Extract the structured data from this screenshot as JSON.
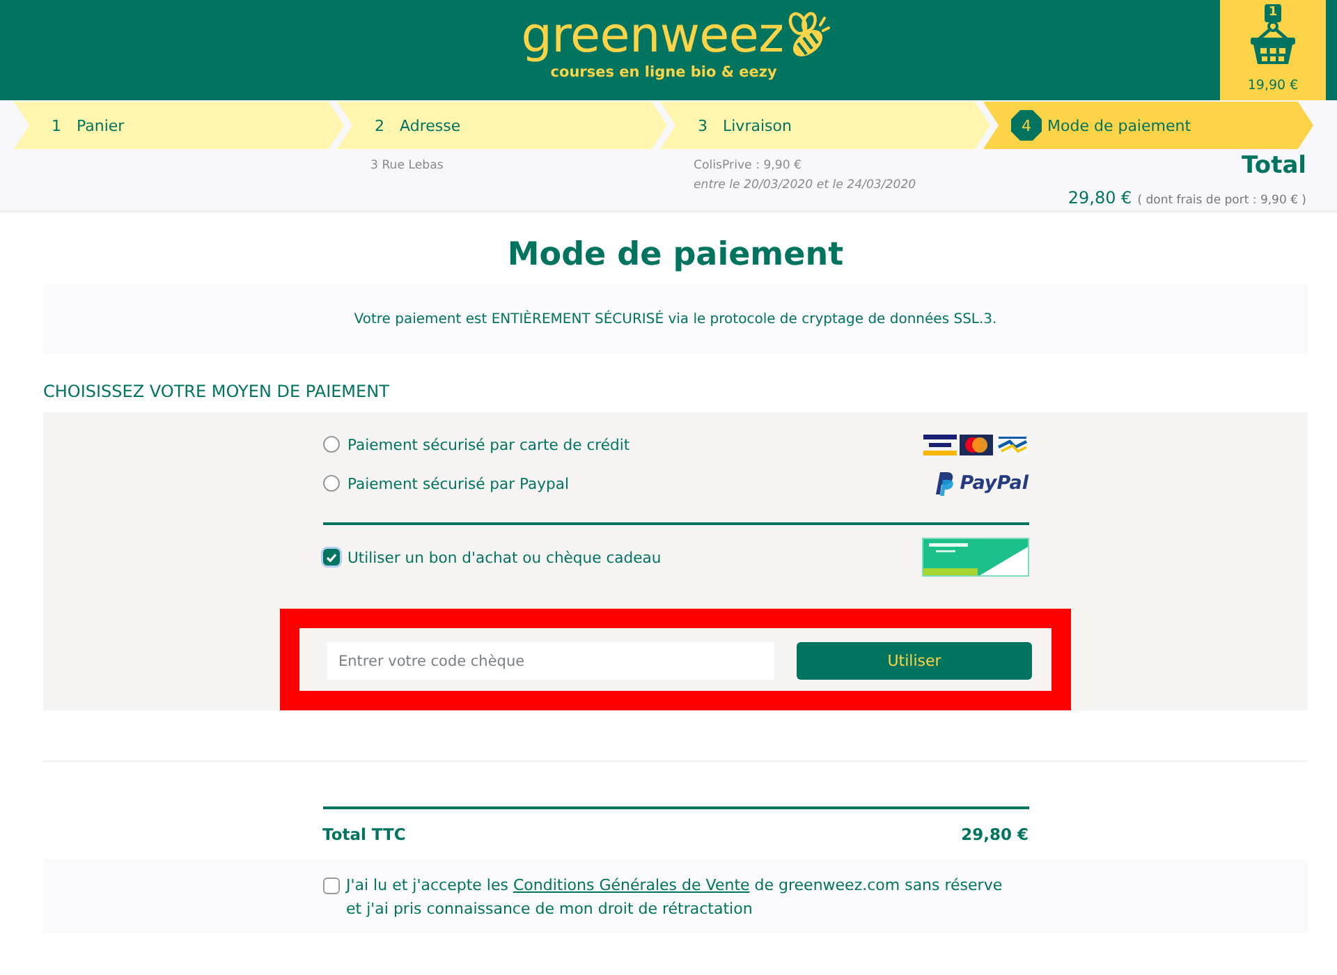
{
  "header": {
    "brand": "greenweez",
    "tagline": "courses en ligne bio & eezy",
    "cart": {
      "count": "1",
      "amount": "19,90 €"
    }
  },
  "steps": [
    {
      "number": "1",
      "label": "Panier",
      "selected": false
    },
    {
      "number": "2",
      "label": "Adresse",
      "selected": false,
      "details": [
        {
          "kind": "plain",
          "text": "3 Rue Lebas"
        }
      ]
    },
    {
      "number": "3",
      "label": "Livraison",
      "selected": false,
      "details": [
        {
          "kind": "plain",
          "text": "ColisPrive : 9,90 €"
        },
        {
          "kind": "note",
          "text": "entre le 20/03/2020 et le 24/03/2020"
        }
      ]
    },
    {
      "number": "4",
      "label": "Mode de paiement",
      "selected": true
    }
  ],
  "order_summary": {
    "title": "Total",
    "amount": "29,80 €",
    "shipping_note": "( dont frais de port : 9,90 € )"
  },
  "page_title": "Mode de paiement",
  "security_notice": "Votre paiement est ENTIÈREMENT SÉCURISÉ via le protocole de cryptage de données SSL.3.",
  "payment": {
    "heading": "CHOISISSEZ VOTRE MOYEN DE PAIEMENT",
    "options": [
      {
        "kind": "radio",
        "label": "Paiement sécurisé par carte de crédit",
        "selected": false,
        "logo": {
          "kind": "cards"
        }
      },
      {
        "kind": "radio",
        "label": "Paiement sécurisé par Paypal",
        "selected": false,
        "logo": {
          "kind": "paypal",
          "text": "PayPal"
        }
      },
      {
        "kind": "checkbox",
        "label": "Utiliser un bon d'achat ou chèque cadeau",
        "checked": true,
        "logo": {
          "kind": "gift-card"
        }
      }
    ],
    "voucher": {
      "highlighted": true,
      "placeholder": "Entrer votre code chèque",
      "button": "Utiliser"
    }
  },
  "total": {
    "label": "Total TTC",
    "amount": "29,80 €"
  },
  "terms": {
    "checked": false,
    "text_before": "J'ai lu et j'accepte les",
    "link": "Conditions Générales de Vente",
    "text_after": "de greenweez.com sans réserve et j'ai pris connaissance de mon droit de rétractation"
  }
}
